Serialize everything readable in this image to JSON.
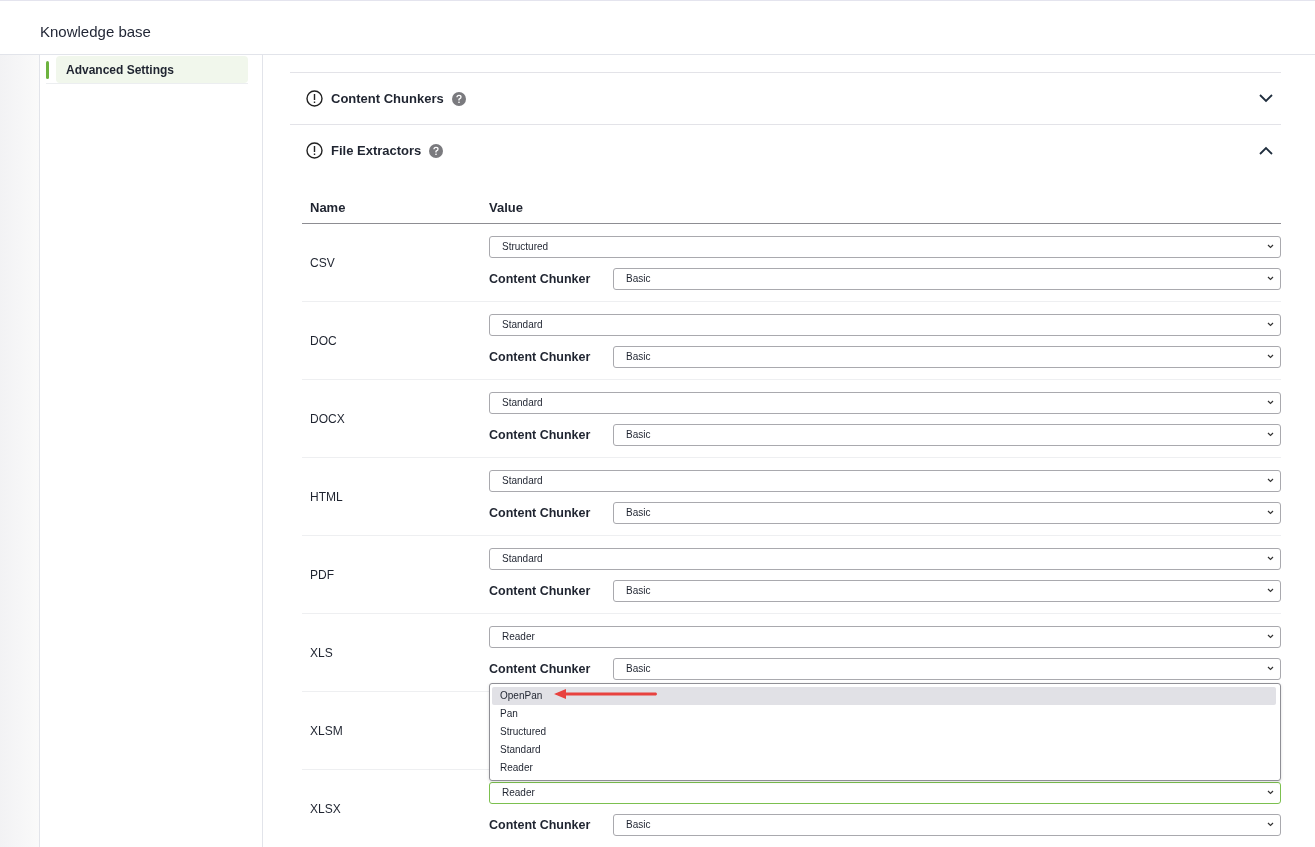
{
  "header": {
    "title": "Knowledge base"
  },
  "sidebar": {
    "items": [
      {
        "label": "Advanced Settings",
        "selected": true
      }
    ]
  },
  "sections": [
    {
      "title": "Content Chunkers",
      "expanded": false
    },
    {
      "title": "File Extractors",
      "expanded": true,
      "table": {
        "columns": [
          "Name",
          "Value"
        ],
        "rows": [
          {
            "name": "CSV",
            "extractor": "Structured",
            "chunker_label": "Content Chunker",
            "chunker": "Basic",
            "focused": false
          },
          {
            "name": "DOC",
            "extractor": "Standard",
            "chunker_label": "Content Chunker",
            "chunker": "Basic",
            "focused": false
          },
          {
            "name": "DOCX",
            "extractor": "Standard",
            "chunker_label": "Content Chunker",
            "chunker": "Basic",
            "focused": false
          },
          {
            "name": "HTML",
            "extractor": "Standard",
            "chunker_label": "Content Chunker",
            "chunker": "Basic",
            "focused": false
          },
          {
            "name": "PDF",
            "extractor": "Standard",
            "chunker_label": "Content Chunker",
            "chunker": "Basic",
            "focused": false
          },
          {
            "name": "XLS",
            "extractor": "Reader",
            "chunker_label": "Content Chunker",
            "chunker": "Basic",
            "focused": false
          },
          {
            "name": "XLSM"
          },
          {
            "name": "XLSX",
            "extractor": "Reader",
            "chunker_label": "Content Chunker",
            "chunker": "Basic",
            "focused": true,
            "menu": {
              "options": [
                {
                  "label": "OpenPan",
                  "selected": true
                },
                {
                  "label": "Pan",
                  "selected": false
                },
                {
                  "label": "Structured",
                  "selected": false
                },
                {
                  "label": "Standard",
                  "selected": false
                },
                {
                  "label": "Reader",
                  "selected": false
                }
              ]
            }
          }
        ]
      }
    }
  ]
}
